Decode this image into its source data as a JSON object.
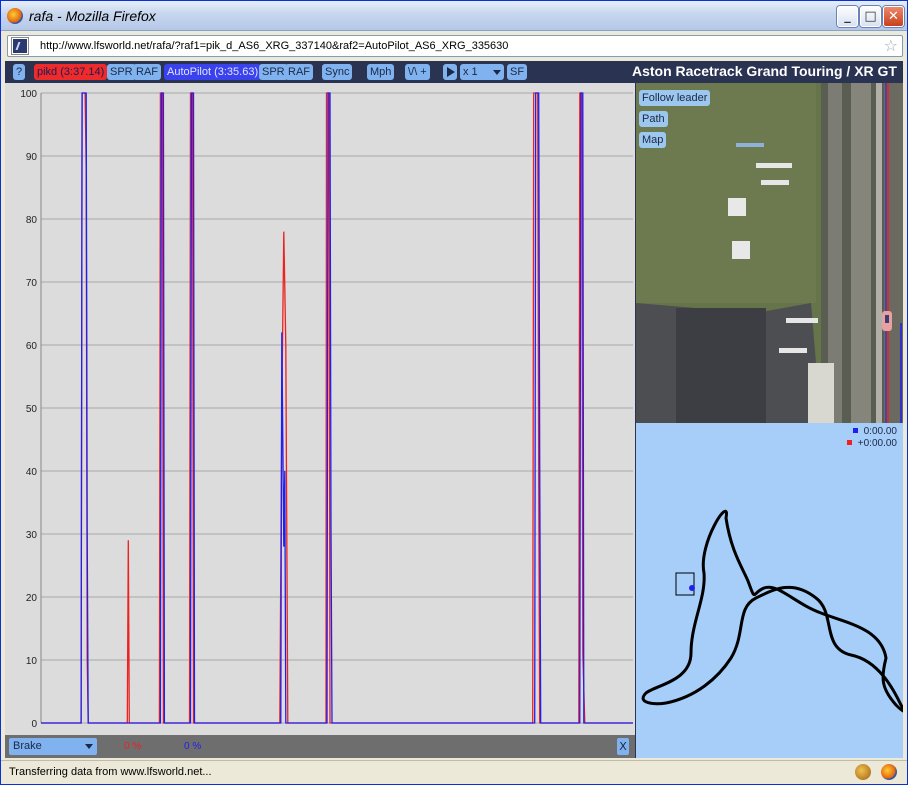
{
  "window": {
    "title": "rafa - Mozilla Firefox",
    "url": "http://www.lfsworld.net/rafa/?raf1=pik_d_AS6_XRG_337140&raf2=AutoPilot_AS6_XRG_335630"
  },
  "toolbar": {
    "help": "?",
    "driver1": "pikd (3:37.14)",
    "spr1": "SPR",
    "raf1": "RAF",
    "driver2": "AutoPilot (3:35.63)",
    "spr2": "SPR",
    "raf2": "RAF",
    "sync": "Sync",
    "units": "Mph",
    "graph_mode": "\\/\\ +",
    "speed": "x 1",
    "sf": "SF",
    "track": "Aston Racetrack Grand Touring / XR GT"
  },
  "map_controls": {
    "follow": "Follow leader",
    "path": "Path",
    "map": "Map"
  },
  "legend": {
    "driver2_time": "0:00.00",
    "driver1_time": "+0:00.00"
  },
  "bottom": {
    "channel": "Brake",
    "driver1_pct": "0 %",
    "driver2_pct": "0 %",
    "close": "X"
  },
  "status": {
    "text": "Transferring data from www.lfsworld.net..."
  },
  "colors": {
    "driver1": "#ee2020",
    "driver2": "#2020ee",
    "accent": "#7fb2ee"
  },
  "chart_data": {
    "type": "line",
    "title": "",
    "ylabel": "",
    "ylim": [
      0,
      100
    ],
    "yticks": [
      "0",
      "10",
      "20",
      "30",
      "40",
      "50",
      "60",
      "70",
      "80",
      "90",
      "100"
    ],
    "series": [
      {
        "name": "pikd",
        "color": "#ee2020",
        "points": [
          [
            0,
            0
          ],
          [
            40,
            0
          ],
          [
            40.5,
            52
          ],
          [
            41,
            100
          ],
          [
            44,
            100
          ],
          [
            45,
            88
          ],
          [
            46,
            10
          ],
          [
            47,
            0
          ],
          [
            86,
            0
          ],
          [
            87,
            29
          ],
          [
            88,
            0
          ],
          [
            118,
            0
          ],
          [
            119,
            100
          ],
          [
            121,
            100
          ],
          [
            122,
            0
          ],
          [
            148,
            0
          ],
          [
            149,
            100
          ],
          [
            151,
            100
          ],
          [
            152,
            0
          ],
          [
            238,
            0
          ],
          [
            240,
            50
          ],
          [
            242,
            78
          ],
          [
            244,
            60
          ],
          [
            246,
            0
          ],
          [
            284,
            0
          ],
          [
            284.5,
            100
          ],
          [
            287,
            100
          ],
          [
            288,
            0
          ],
          [
            490,
            0
          ],
          [
            491,
            100
          ],
          [
            495,
            100
          ],
          [
            496,
            40
          ],
          [
            497,
            0
          ],
          [
            536,
            0
          ],
          [
            537,
            100
          ],
          [
            539,
            100
          ],
          [
            540,
            11
          ],
          [
            542,
            0
          ],
          [
            590,
            0
          ]
        ]
      },
      {
        "name": "AutoPilot",
        "color": "#2020ee",
        "points": [
          [
            0,
            0
          ],
          [
            40,
            0
          ],
          [
            41,
            100
          ],
          [
            45,
            100
          ],
          [
            46,
            30
          ],
          [
            47,
            0
          ],
          [
            119,
            0
          ],
          [
            120,
            100
          ],
          [
            122,
            100
          ],
          [
            123,
            0
          ],
          [
            149,
            0
          ],
          [
            150,
            100
          ],
          [
            152,
            100
          ],
          [
            153,
            0
          ],
          [
            239,
            0
          ],
          [
            240,
            62
          ],
          [
            242,
            28
          ],
          [
            243,
            40
          ],
          [
            244,
            0
          ],
          [
            285,
            0
          ],
          [
            286,
            100
          ],
          [
            288,
            100
          ],
          [
            289,
            31
          ],
          [
            290,
            0
          ],
          [
            492,
            0
          ],
          [
            493,
            100
          ],
          [
            496,
            100
          ],
          [
            497,
            42
          ],
          [
            498,
            0
          ],
          [
            537,
            0
          ],
          [
            538,
            100
          ],
          [
            540,
            100
          ],
          [
            541,
            0
          ],
          [
            590,
            0
          ]
        ]
      }
    ]
  }
}
